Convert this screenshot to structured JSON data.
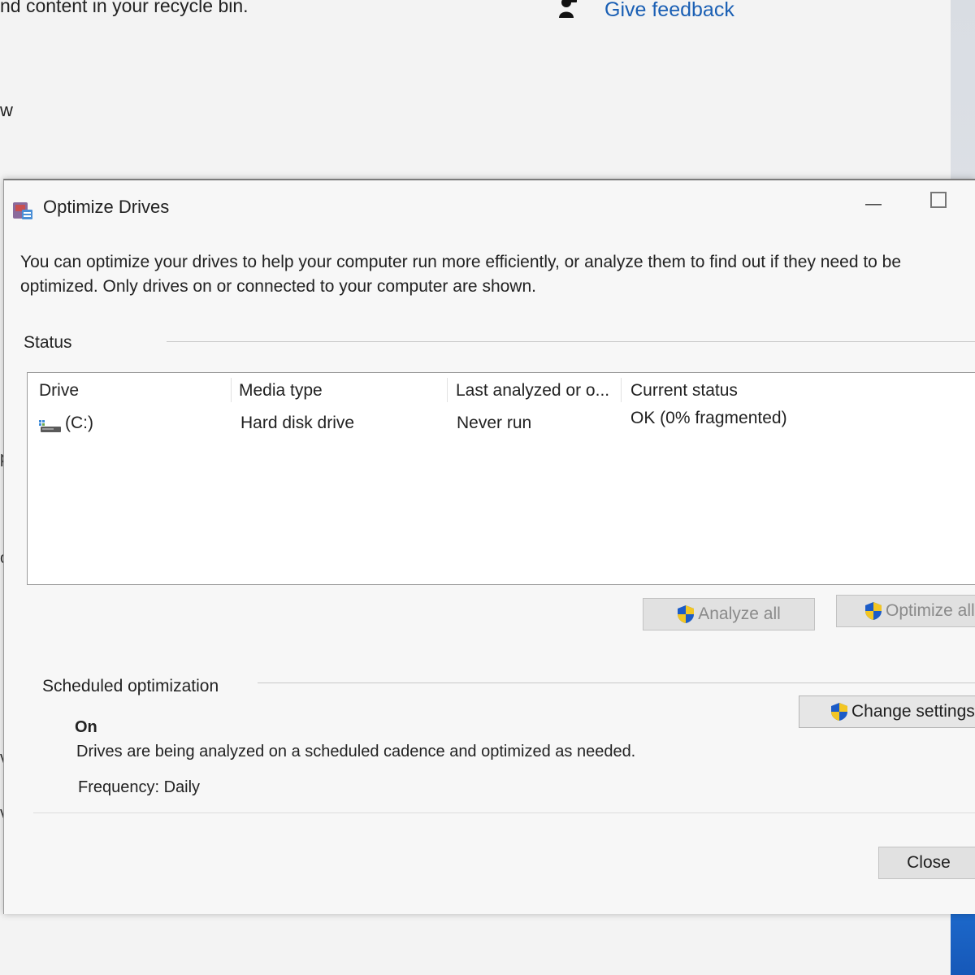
{
  "background": {
    "top_text": "nd content in your recycle bin.",
    "feedback_link": "Give feedback",
    "feedback_icon": "person-feedback-icon",
    "side_fragments": [
      "w",
      "pg",
      "o r",
      "ves",
      "ved"
    ]
  },
  "dialog": {
    "title": "Optimize Drives",
    "title_icon": "optimize-drives-icon",
    "description": "You can optimize your drives to help your computer run more efficiently, or analyze them to find out if they need to be optimized. Only drives on or connected to your computer are shown.",
    "status_section": {
      "label": "Status",
      "columns": [
        "Drive",
        "Media type",
        "Last analyzed or o...",
        "Current status"
      ],
      "rows": [
        {
          "drive": "(C:)",
          "media_type": "Hard disk drive",
          "last_analyzed": "Never run",
          "current_status": "OK (0% fragmented)",
          "icon": "hard-drive-icon"
        }
      ],
      "analyze_all_label": "Analyze all",
      "optimize_all_label": "Optimize all"
    },
    "scheduled_section": {
      "label": "Scheduled optimization",
      "state": "On",
      "description": "Drives are being analyzed on a scheduled cadence and optimized as needed.",
      "frequency": "Frequency: Daily",
      "change_settings_label": "Change settings"
    },
    "close_label": "Close",
    "colors": {
      "accent_link": "#1a5fb4",
      "shield_blue": "#1c5cc7",
      "shield_yellow": "#f3c623",
      "taskbar_blue": "#1658b8"
    }
  }
}
